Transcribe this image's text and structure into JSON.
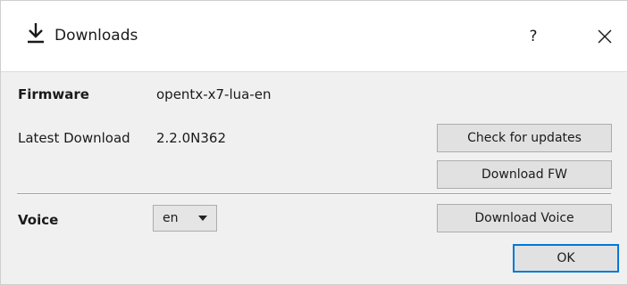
{
  "window": {
    "title": "Downloads",
    "help_label": "?"
  },
  "firmware": {
    "label": "Firmware",
    "value": "opentx-x7-lua-en"
  },
  "latest_download": {
    "label": "Latest Download",
    "value": "2.2.0N362"
  },
  "buttons": {
    "check_updates": "Check for updates",
    "download_fw": "Download FW",
    "download_voice": "Download Voice",
    "ok": "OK"
  },
  "voice": {
    "label": "Voice",
    "selected": "en"
  },
  "colors": {
    "default_button_border": "#0078d7",
    "dialog_background": "#f0f0f0"
  },
  "icons": {
    "title": "download-arrow-icon",
    "close": "close-icon",
    "dropdown": "chevron-down-icon"
  }
}
